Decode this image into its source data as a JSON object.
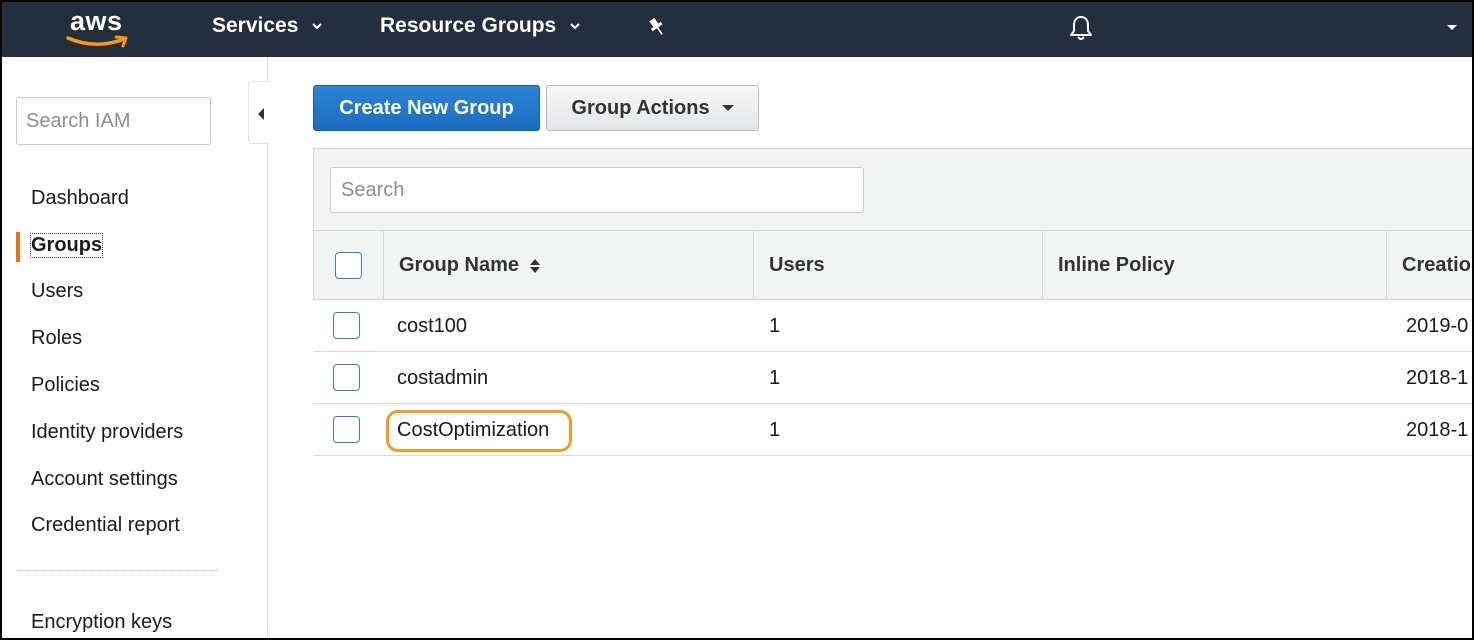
{
  "topnav": {
    "logo_text": "aws",
    "services_label": "Services",
    "resource_groups_label": "Resource Groups",
    "brand_color": "#232f3e",
    "logo_smile_color": "#ff9900"
  },
  "sidebar": {
    "search_placeholder": "Search IAM",
    "items": [
      {
        "label": "Dashboard",
        "active": false
      },
      {
        "label": "Groups",
        "active": true
      },
      {
        "label": "Users",
        "active": false
      },
      {
        "label": "Roles",
        "active": false
      },
      {
        "label": "Policies",
        "active": false
      },
      {
        "label": "Identity providers",
        "active": false
      },
      {
        "label": "Account settings",
        "active": false
      },
      {
        "label": "Credential report",
        "active": false
      }
    ],
    "footer_item": "Encryption keys",
    "active_color": "#ec7211"
  },
  "toolbar": {
    "create_label": "Create New Group",
    "actions_label": "Group Actions",
    "primary_color": "#1f75cb"
  },
  "table": {
    "search_placeholder": "Search",
    "columns": [
      "Group Name",
      "Users",
      "Inline Policy",
      "Creatio"
    ],
    "rows": [
      {
        "name": "cost100",
        "users": "1",
        "inline_policy": "",
        "created": "2019-0"
      },
      {
        "name": "costadmin",
        "users": "1",
        "inline_policy": "",
        "created": "2018-1"
      },
      {
        "name": "CostOptimization",
        "users": "1",
        "inline_policy": "",
        "created": "2018-1"
      }
    ],
    "highlight_color": "#f39c1f"
  }
}
